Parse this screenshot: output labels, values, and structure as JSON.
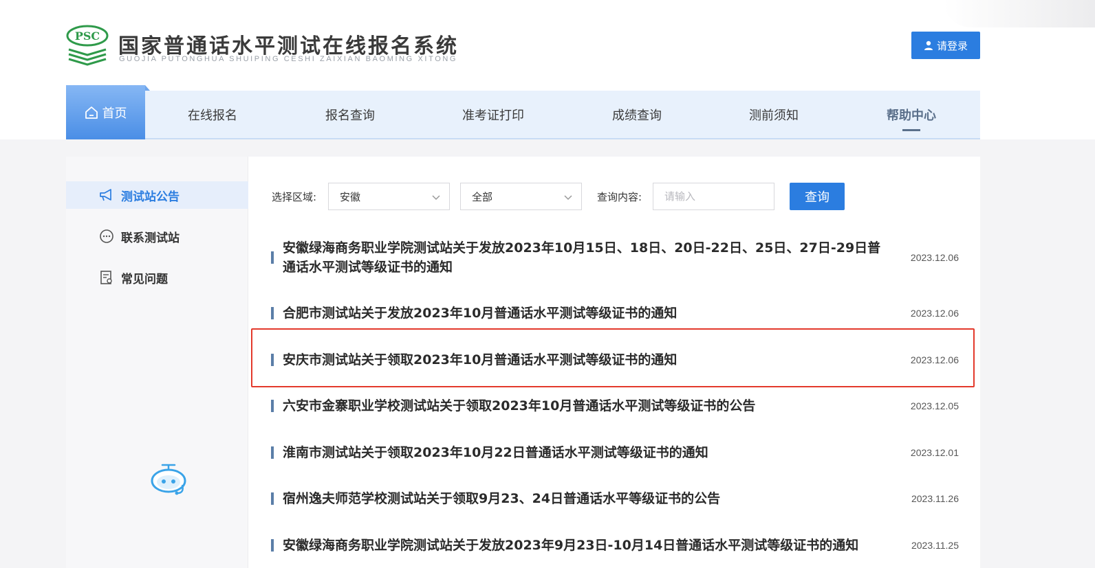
{
  "header": {
    "title": "国家普通话水平测试在线报名系统",
    "subtitle": "GUOJIA PUTONGHUA SHUIPING CESHI ZAIXIAN BAOMING XITONG",
    "logo_text": "PSC",
    "login_label": "请登录"
  },
  "nav": {
    "home": "首页",
    "items": [
      "在线报名",
      "报名查询",
      "准考证打印",
      "成绩查询",
      "测前须知",
      "帮助中心"
    ]
  },
  "sidebar": {
    "items": [
      "测试站公告",
      "联系测试站",
      "常见问题"
    ]
  },
  "filter": {
    "region_label": "选择区域:",
    "province": "安徽",
    "city": "全部",
    "content_label": "查询内容:",
    "placeholder": "请输入",
    "query_label": "查询"
  },
  "notices": [
    {
      "title": "安徽绿海商务职业学院测试站关于发放2023年10月15日、18日、20日-22日、25日、27日-29日普通话水平测试等级证书的通知",
      "date": "2023.12.06"
    },
    {
      "title": "合肥市测试站关于发放2023年10月普通话水平测试等级证书的通知",
      "date": "2023.12.06"
    },
    {
      "title": "安庆市测试站关于领取2023年10月普通话水平测试等级证书的通知",
      "date": "2023.12.06"
    },
    {
      "title": "六安市金寨职业学校测试站关于领取2023年10月普通话水平测试等级证书的公告",
      "date": "2023.12.05"
    },
    {
      "title": "淮南市测试站关于领取2023年10月22日普通话水平测试等级证书的通知",
      "date": "2023.12.01"
    },
    {
      "title": "宿州逸夫师范学校测试站关于领取9月23、24日普通话水平等级证书的公告",
      "date": "2023.11.26"
    },
    {
      "title": "安徽绿海商务职业学院测试站关于发放2023年9月23日-10月14日普通话水平测试等级证书的通知",
      "date": "2023.11.25"
    }
  ],
  "colors": {
    "accent": "#2b7de0",
    "highlight": "#e3392b",
    "logo_green": "#2f9a4a"
  }
}
